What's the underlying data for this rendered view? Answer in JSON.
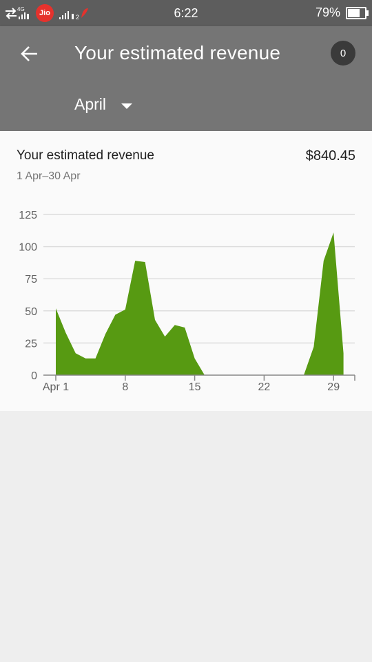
{
  "status_bar": {
    "left_icons": [
      "data-transfer-icon",
      "network-4g-icon",
      "signal-icon",
      "jio-icon",
      "signal-icon",
      "airtel-icon"
    ],
    "jio_label": "Jio",
    "time": "6:22",
    "battery_percent": "79%",
    "battery_level": 0.79
  },
  "header": {
    "title": "Your estimated revenue",
    "notification_count": "0",
    "month": "April"
  },
  "card": {
    "title": "Your estimated revenue",
    "amount": "$840.45",
    "date_range": "1 Apr–30 Apr"
  },
  "colors": {
    "status_bar": "#5d5d5d",
    "app_bar": "#757575",
    "chart_fill": "#579a12",
    "background": "#eeeeee"
  },
  "chart_data": {
    "type": "area",
    "x": [
      1,
      2,
      3,
      4,
      5,
      6,
      7,
      8,
      9,
      10,
      11,
      12,
      13,
      14,
      15,
      16,
      17,
      18,
      19,
      20,
      21,
      22,
      23,
      24,
      25,
      26,
      27,
      28,
      29,
      30
    ],
    "series": [
      {
        "values": [
          52,
          33,
          17,
          13,
          13,
          32,
          47,
          51,
          89,
          88,
          43,
          30,
          39,
          37,
          13,
          0,
          0,
          0,
          0,
          0,
          0,
          0,
          0,
          0,
          0,
          0,
          22,
          89,
          111,
          17
        ]
      }
    ],
    "xticks": [
      1,
      8,
      15,
      22,
      29
    ],
    "xtick_labels": [
      "Apr 1",
      "8",
      "15",
      "22",
      "29"
    ],
    "yticks": [
      0,
      25,
      50,
      75,
      100,
      125
    ],
    "ytick_labels": [
      "0",
      "25",
      "50",
      "75",
      "100",
      "125"
    ],
    "ylim": [
      0,
      125
    ],
    "xlim": [
      1,
      31
    ],
    "grid": true
  }
}
